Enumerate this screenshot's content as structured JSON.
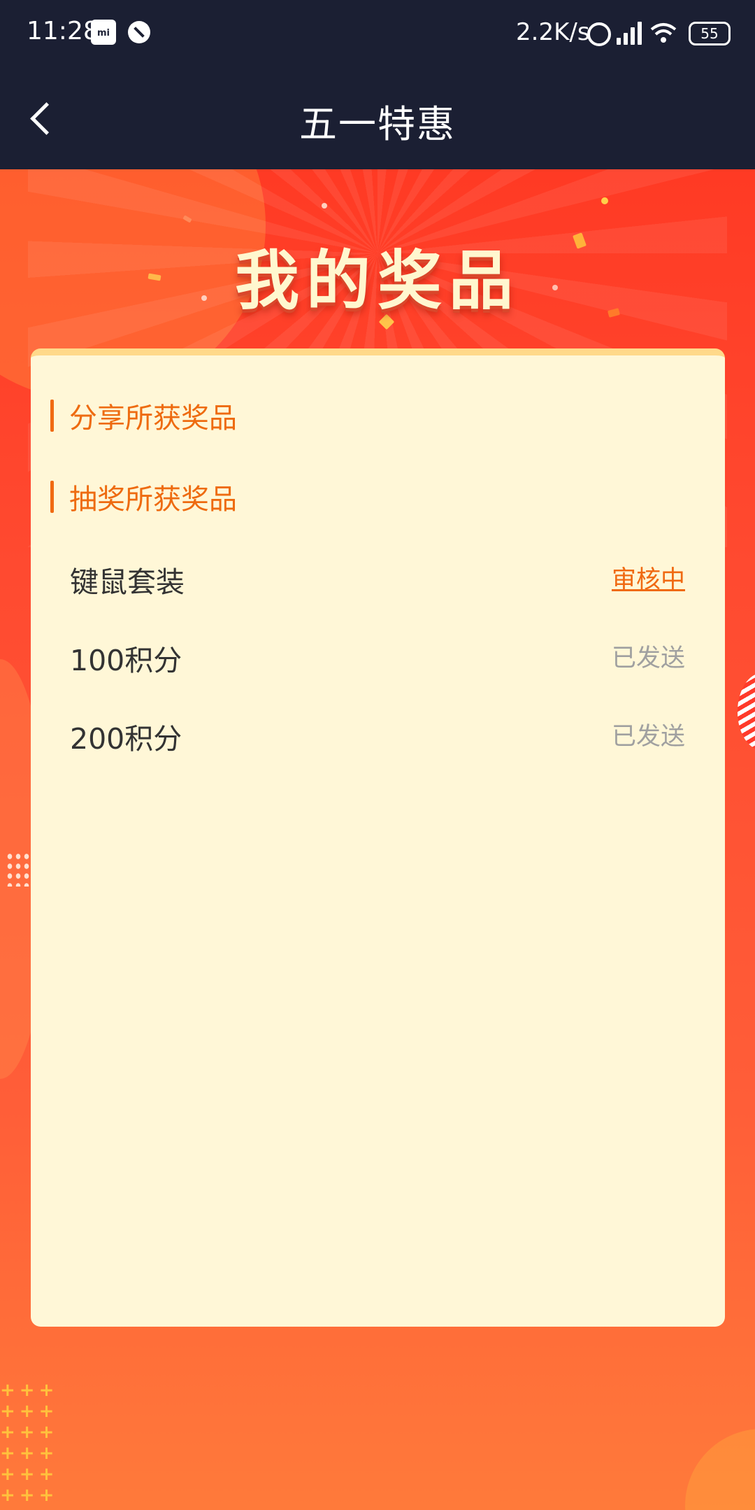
{
  "status_bar": {
    "time": "11:28",
    "mi_icon_text": "mi",
    "network_speed": "2.2K/s",
    "battery": "55"
  },
  "app_bar": {
    "title": "五一特惠"
  },
  "banner": {
    "title": "我的奖品"
  },
  "sections": [
    {
      "label": "分享所获奖品"
    },
    {
      "label": "抽奖所获奖品"
    }
  ],
  "prizes": [
    {
      "name": "键鼠套装",
      "status": "审核中",
      "status_color": "#f06a12"
    },
    {
      "name": "100积分",
      "status": "已发送",
      "status_color": "#a0a0a0"
    },
    {
      "name": "200积分",
      "status": "已发送",
      "status_color": "#a0a0a0"
    }
  ],
  "colors": {
    "header_bg": "#1b1f33",
    "accent": "#f06a12",
    "card_bg": "#fff7d7",
    "page_bg": "#ff3a24"
  }
}
